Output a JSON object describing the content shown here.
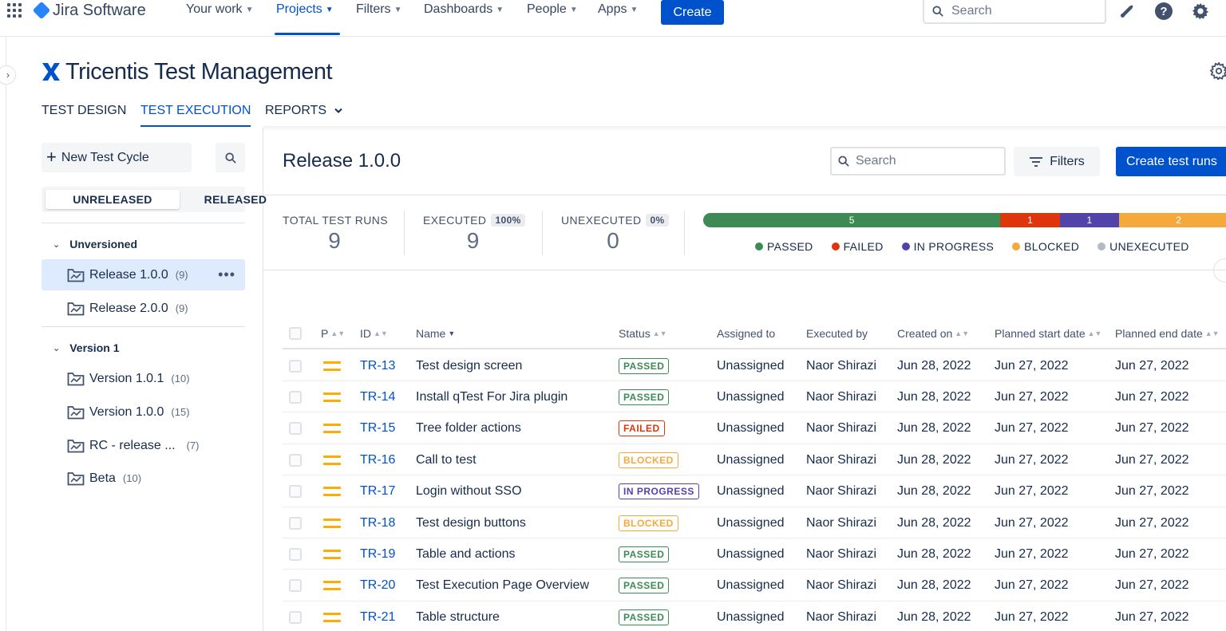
{
  "topnav": {
    "app_name": "Jira Software",
    "items": [
      {
        "label": "Your work",
        "active": false
      },
      {
        "label": "Projects",
        "active": true
      },
      {
        "label": "Filters",
        "active": false
      },
      {
        "label": "Dashboards",
        "active": false
      },
      {
        "label": "People",
        "active": false
      },
      {
        "label": "Apps",
        "active": false
      }
    ],
    "create_label": "Create",
    "search_placeholder": "Search",
    "icons": [
      "notifications-icon",
      "help-icon",
      "settings-icon"
    ]
  },
  "app": {
    "title": "Tricentis Test Management",
    "tabs": [
      {
        "label": "TEST DESIGN",
        "active": false
      },
      {
        "label": "TEST EXECUTION",
        "active": true
      },
      {
        "label": "REPORTS",
        "active": false
      }
    ]
  },
  "sidebar": {
    "new_cycle_label": "New Test Cycle",
    "segments": [
      "UNRELEASED",
      "RELEASED"
    ],
    "groups": [
      {
        "label": "Unversioned",
        "items": [
          {
            "label": "Release 1.0.0",
            "count": "(9)",
            "selected": true
          },
          {
            "label": "Release 2.0.0",
            "count": "(9)",
            "selected": false
          }
        ]
      },
      {
        "label": "Version 1",
        "items": [
          {
            "label": "Version 1.0.1",
            "count": "(10)",
            "selected": false
          },
          {
            "label": "Version 1.0.0",
            "count": "(15)",
            "selected": false
          },
          {
            "label": "RC - release ...",
            "count": "(7)",
            "selected": false
          },
          {
            "label": "Beta",
            "count": "(10)",
            "selected": false
          }
        ]
      }
    ]
  },
  "main": {
    "title": "Release 1.0.0",
    "search_placeholder": "Search",
    "filters_label": "Filters",
    "create_runs_label": "Create test runs",
    "stats": {
      "total_label": "TOTAL TEST RUNS",
      "total_value": "9",
      "executed_label": "EXECUTED",
      "executed_pct": "100%",
      "executed_value": "9",
      "unexecuted_label": "UNEXECUTED",
      "unexecuted_pct": "0%",
      "unexecuted_value": "0"
    },
    "progress": [
      {
        "label": "5",
        "value": 5,
        "color": "#3d8a55"
      },
      {
        "label": "1",
        "value": 1,
        "color": "#de350b"
      },
      {
        "label": "1",
        "value": 1,
        "color": "#5243aa"
      },
      {
        "label": "2",
        "value": 2,
        "color": "#f5a83b"
      }
    ],
    "legend": [
      {
        "label": "PASSED",
        "color": "#3d8a55"
      },
      {
        "label": "FAILED",
        "color": "#de350b"
      },
      {
        "label": "IN PROGRESS",
        "color": "#5243aa"
      },
      {
        "label": "BLOCKED",
        "color": "#f5a83b"
      },
      {
        "label": "UNEXECUTED",
        "color": "#b3bac5"
      }
    ]
  },
  "status_colors": {
    "PASSED": "#3d8a55",
    "FAILED": "#de350b",
    "BLOCKED": "#f5a83b",
    "IN PROGRESS": "#5243aa"
  },
  "table": {
    "columns": [
      "P",
      "ID",
      "Name",
      "Status",
      "Assigned to",
      "Executed by",
      "Created on",
      "Planned start date",
      "Planned end date"
    ],
    "rows": [
      {
        "id": "TR-13",
        "name": "Test design screen",
        "status": "PASSED",
        "assigned": "Unassigned",
        "executed": "Naor Shirazi",
        "created": "Jun 28, 2022",
        "start": "Jun 27, 2022",
        "end": "Jun 27, 2022"
      },
      {
        "id": "TR-14",
        "name": "Install qTest For Jira plugin",
        "status": "PASSED",
        "assigned": "Unassigned",
        "executed": "Naor Shirazi",
        "created": "Jun 28, 2022",
        "start": "Jun 27, 2022",
        "end": "Jun 27, 2022"
      },
      {
        "id": "TR-15",
        "name": "Tree folder actions",
        "status": "FAILED",
        "assigned": "Unassigned",
        "executed": "Naor Shirazi",
        "created": "Jun 28, 2022",
        "start": "Jun 27, 2022",
        "end": "Jun 27, 2022"
      },
      {
        "id": "TR-16",
        "name": "Call to test",
        "status": "BLOCKED",
        "assigned": "Unassigned",
        "executed": "Naor Shirazi",
        "created": "Jun 28, 2022",
        "start": "Jun 27, 2022",
        "end": "Jun 27, 2022"
      },
      {
        "id": "TR-17",
        "name": "Login without SSO",
        "status": "IN PROGRESS",
        "assigned": "Unassigned",
        "executed": "Naor Shirazi",
        "created": "Jun 28, 2022",
        "start": "Jun 27, 2022",
        "end": "Jun 27, 2022"
      },
      {
        "id": "TR-18",
        "name": "Test design buttons",
        "status": "BLOCKED",
        "assigned": "Unassigned",
        "executed": "Naor Shirazi",
        "created": "Jun 28, 2022",
        "start": "Jun 27, 2022",
        "end": "Jun 27, 2022"
      },
      {
        "id": "TR-19",
        "name": "Table and actions",
        "status": "PASSED",
        "assigned": "Unassigned",
        "executed": "Naor Shirazi",
        "created": "Jun 28, 2022",
        "start": "Jun 27, 2022",
        "end": "Jun 27, 2022"
      },
      {
        "id": "TR-20",
        "name": "Test Execution Page Overview",
        "status": "PASSED",
        "assigned": "Unassigned",
        "executed": "Naor Shirazi",
        "created": "Jun 28, 2022",
        "start": "Jun 27, 2022",
        "end": "Jun 27, 2022"
      },
      {
        "id": "TR-21",
        "name": "Table structure",
        "status": "PASSED",
        "assigned": "Unassigned",
        "executed": "Naor Shirazi",
        "created": "Jun 28, 2022",
        "start": "Jun 27, 2022",
        "end": "Jun 27, 2022"
      }
    ]
  }
}
